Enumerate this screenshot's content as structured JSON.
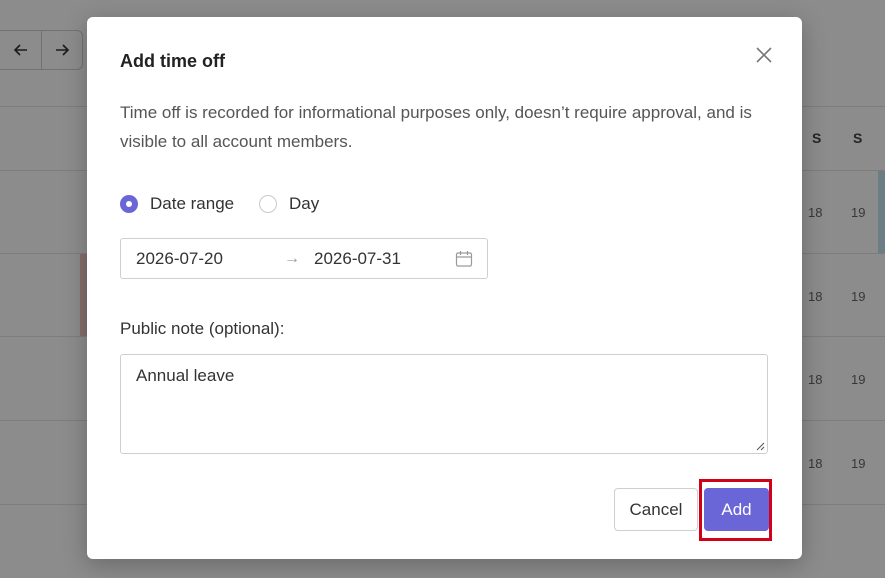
{
  "background": {
    "weekday_headers": [
      "S",
      "S"
    ],
    "rows": [
      {
        "day1": "18",
        "day2": "19"
      },
      {
        "day1": "18",
        "day2": "19"
      },
      {
        "day1": "18",
        "day2": "19"
      },
      {
        "day1": "18",
        "day2": "19"
      }
    ]
  },
  "modal": {
    "title": "Add time off",
    "description": "Time off is recorded for informational purposes only, doesn’t require approval, and is visible to all account members.",
    "mode_options": [
      {
        "label": "Date range",
        "selected": true
      },
      {
        "label": "Day",
        "selected": false
      }
    ],
    "date_start": "2026-07-20",
    "date_arrow": "→",
    "date_end": "2026-07-31",
    "note_label": "Public note (optional):",
    "note_value": "Annual leave",
    "cancel_label": "Cancel",
    "add_label": "Add"
  },
  "colors": {
    "accent": "#6b66d8",
    "highlight": "#d0021b"
  }
}
